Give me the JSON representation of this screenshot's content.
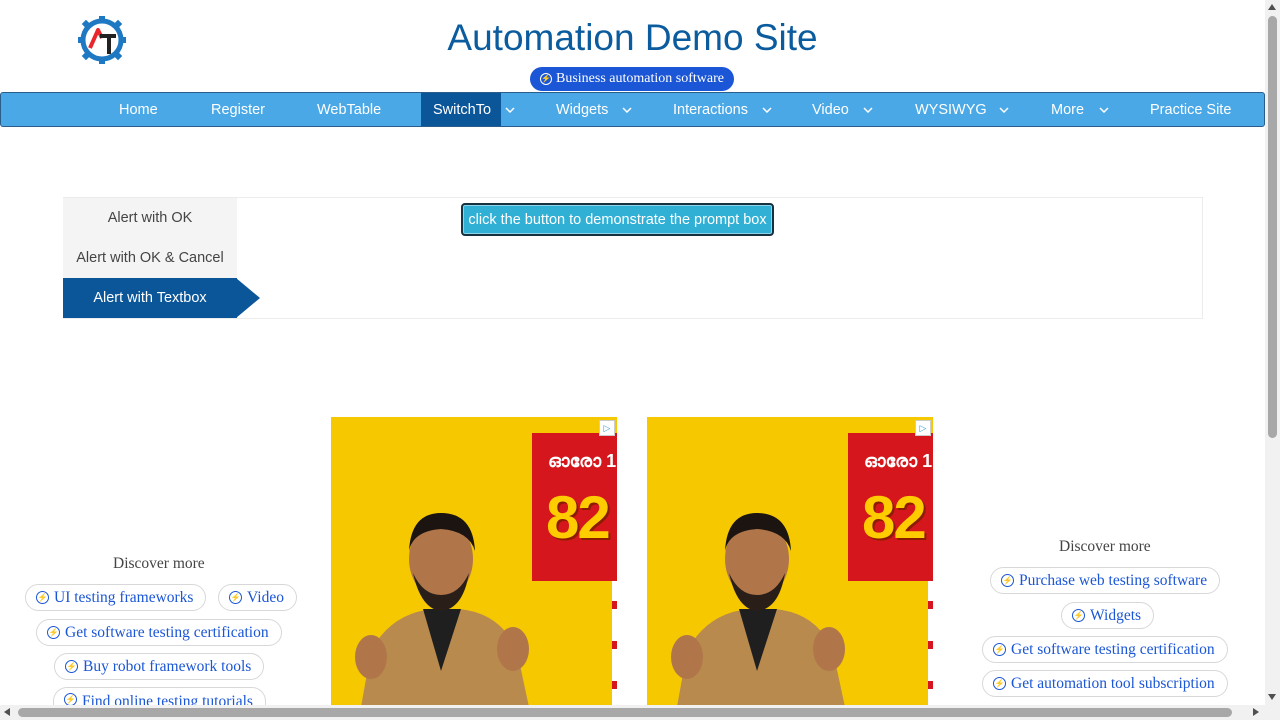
{
  "header": {
    "title": "Automation Demo Site",
    "ad_pill": "Business automation software"
  },
  "nav": {
    "items": [
      {
        "label": "Home"
      },
      {
        "label": "Register"
      },
      {
        "label": "WebTable"
      },
      {
        "label": "SwitchTo",
        "active": true
      },
      {
        "label": "Widgets"
      },
      {
        "label": "Interactions"
      },
      {
        "label": "Video"
      },
      {
        "label": "WYSIWYG"
      },
      {
        "label": "More"
      },
      {
        "label": "Practice Site"
      }
    ]
  },
  "tabs": [
    {
      "label": "Alert with OK"
    },
    {
      "label": "Alert with OK & Cancel"
    },
    {
      "label": "Alert with Textbox",
      "active": true
    }
  ],
  "prompt_button": "click the button to demonstrate the prompt box",
  "discover_left": {
    "title": "Discover more",
    "chips": [
      "UI testing frameworks",
      "Video",
      "Get software testing certification",
      "Buy robot framework tools",
      "Find online testing tutorials"
    ]
  },
  "discover_right": {
    "title": "Discover more",
    "chips": [
      "Purchase web testing software",
      "Widgets",
      "Get software testing certification",
      "Get automation tool subscription"
    ]
  },
  "ads": [
    {
      "top_text": "ഓരോ 1",
      "number": "82"
    },
    {
      "top_text": "ഓരോ 1",
      "number": "82"
    }
  ],
  "colors": {
    "title_blue": "#0b5c9e",
    "nav_bg": "#4aa8e6",
    "nav_active": "#0b5599",
    "button_bg": "#31b0d5",
    "link_blue": "#1a56d6",
    "ad_yellow": "#f6c800",
    "ad_red": "#d5161c"
  }
}
